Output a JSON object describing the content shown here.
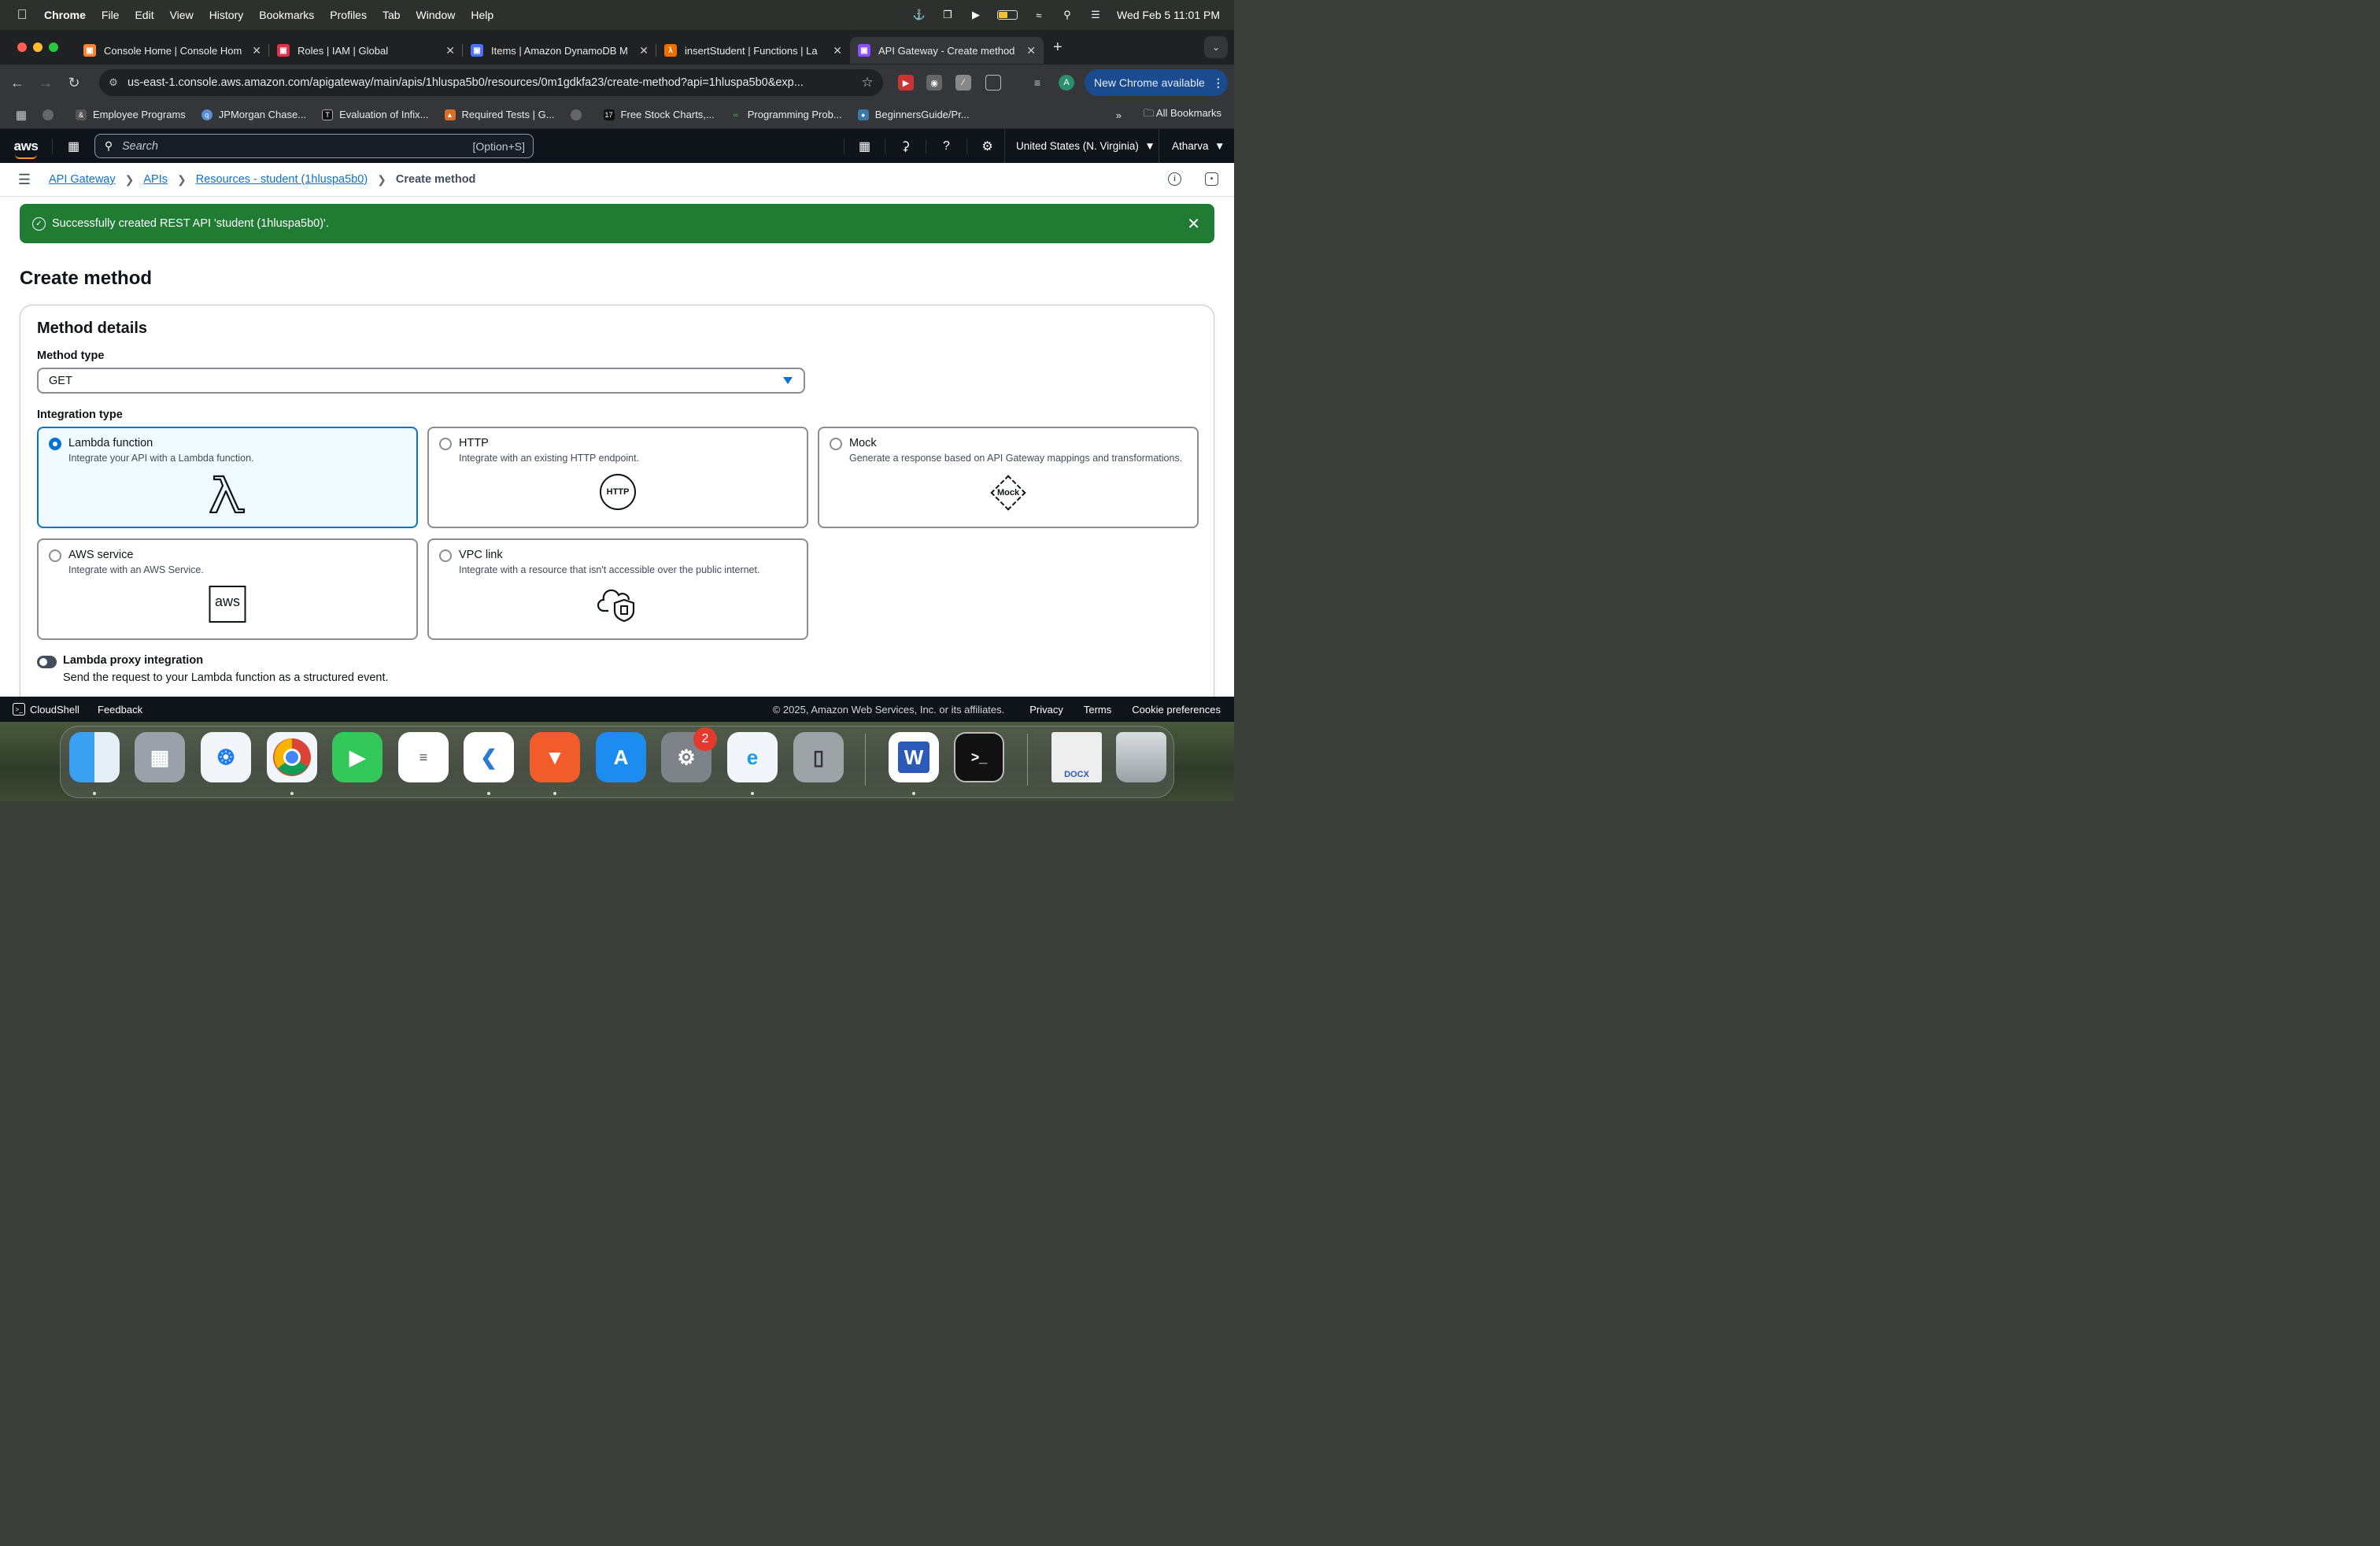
{
  "menubar": {
    "app": "Chrome",
    "items": [
      "File",
      "Edit",
      "View",
      "History",
      "Bookmarks",
      "Profiles",
      "Tab",
      "Window",
      "Help"
    ],
    "datetime": "Wed Feb 5  11:01 PM"
  },
  "tabs": [
    {
      "title": "Console Home | Console Hom",
      "color": "#f58536"
    },
    {
      "title": "Roles | IAM | Global",
      "color": "#dd344c"
    },
    {
      "title": "Items | Amazon DynamoDB M",
      "color": "#4d72f3"
    },
    {
      "title": "insertStudent | Functions | La",
      "color": "#ed7100"
    },
    {
      "title": "API Gateway - Create method",
      "color": "#8c4fff"
    }
  ],
  "toolbar": {
    "url": "us-east-1.console.aws.amazon.com/apigateway/main/apis/1hluspa5b0/resources/0m1gdkfa23/create-method?api=1hluspa5b0&exp...",
    "profile_initial": "A",
    "new_chrome": "New Chrome available"
  },
  "bookmarks": {
    "items": [
      "Employee Programs",
      "JPMorgan Chase...",
      "Evaluation of Infix...",
      "Required Tests | G...",
      "Free Stock Charts,...",
      "Programming Prob...",
      "BeginnersGuide/Pr..."
    ],
    "more": "»",
    "all": "All Bookmarks"
  },
  "aws": {
    "logo": "aws",
    "search_placeholder": "Search",
    "search_shortcut": "[Option+S]",
    "region": "United States (N. Virginia)",
    "user": "Atharva"
  },
  "breadcrumb": {
    "items": [
      "API Gateway",
      "APIs",
      "Resources - student (1hluspa5b0)"
    ],
    "current": "Create method"
  },
  "flash": {
    "message": "Successfully created REST API 'student (1hluspa5b0)'."
  },
  "page": {
    "title": "Create method",
    "section_title": "Method details",
    "method_type_label": "Method type",
    "method_type_value": "GET",
    "integration_type_label": "Integration type",
    "integration_options": [
      {
        "name": "Lambda function",
        "desc": "Integrate your API with a Lambda function.",
        "selected": true,
        "icon": "lambda-icon"
      },
      {
        "name": "HTTP",
        "desc": "Integrate with an existing HTTP endpoint.",
        "selected": false,
        "icon": "http-icon",
        "icon_text": "HTTP"
      },
      {
        "name": "Mock",
        "desc": "Generate a response based on API Gateway mappings and transformations.",
        "selected": false,
        "icon": "mock-icon",
        "icon_text": "Mock"
      },
      {
        "name": "AWS service",
        "desc": "Integrate with an AWS Service.",
        "selected": false,
        "icon": "aws-service-icon",
        "icon_text": "aws"
      },
      {
        "name": "VPC link",
        "desc": "Integrate with a resource that isn't accessible over the public internet.",
        "selected": false,
        "icon": "vpc-link-icon"
      }
    ],
    "proxy_label": "Lambda proxy integration",
    "proxy_desc": "Send the request to your Lambda function as a structured event.",
    "proxy_enabled": false
  },
  "footer": {
    "cloudshell": "CloudShell",
    "feedback": "Feedback",
    "copyright": "© 2025, Amazon Web Services, Inc. or its affiliates.",
    "links": [
      "Privacy",
      "Terms",
      "Cookie preferences"
    ]
  },
  "dock": {
    "settings_badge": "2",
    "word_letter": "W",
    "terminal_glyph": ">_",
    "doc_label": "DOCX"
  },
  "colors": {
    "accent": "#0972d3",
    "success": "#1f7c32",
    "aws_header": "#0f141a"
  }
}
